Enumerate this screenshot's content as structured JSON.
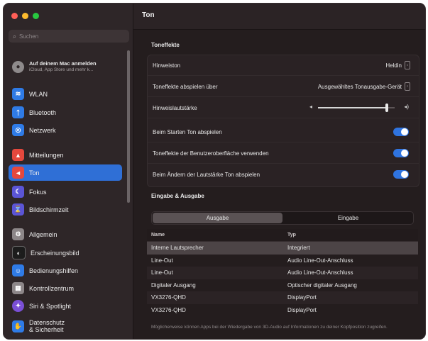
{
  "sidebar": {
    "search_placeholder": "Suchen",
    "account": {
      "line1": "Auf deinem Mac anmelden",
      "line2": "iCloud, App Store und mehr k..."
    },
    "items": [
      {
        "label": "WLAN",
        "icon": "wifi-icon",
        "color": "#2f7be6"
      },
      {
        "label": "Bluetooth",
        "icon": "bluetooth-icon",
        "color": "#2f7be6"
      },
      {
        "label": "Netzwerk",
        "icon": "globe-icon",
        "color": "#2f7be6"
      },
      {
        "label": "Mitteilungen",
        "icon": "bell-icon",
        "color": "#e5483d"
      },
      {
        "label": "Ton",
        "icon": "speaker-icon",
        "color": "#e5483d"
      },
      {
        "label": "Fokus",
        "icon": "moon-icon",
        "color": "#5b55d6"
      },
      {
        "label": "Bildschirmzeit",
        "icon": "hourglass-icon",
        "color": "#5b55d6"
      },
      {
        "label": "Allgemein",
        "icon": "gear-icon",
        "color": "#8c8688"
      },
      {
        "label": "Erscheinungsbild",
        "icon": "appearance-icon",
        "color": "#1c1c1c"
      },
      {
        "label": "Bedienungshilfen",
        "icon": "accessibility-icon",
        "color": "#2f7be6"
      },
      {
        "label": "Kontrollzentrum",
        "icon": "control-center-icon",
        "color": "#8c8688"
      },
      {
        "label": "Siri & Spotlight",
        "icon": "siri-icon",
        "color": "#7a4fd6"
      },
      {
        "label": "Datenschutz\n& Sicherheit",
        "icon": "hand-icon",
        "color": "#2f7be6"
      }
    ],
    "selected": "Ton"
  },
  "header": {
    "title": "Ton"
  },
  "toneffekte": {
    "heading": "Toneffekte",
    "hinweiston_label": "Hinweiston",
    "hinweiston_value": "Heldin",
    "abspielen_label": "Toneffekte abspielen über",
    "abspielen_value": "Ausgewähltes Tonausgabe-Gerät",
    "lautstaerke_label": "Hinweislautstärke",
    "lautstaerke_level": 0.9,
    "start_label": "Beim Starten Ton abspielen",
    "start_on": true,
    "ui_label": "Toneffekte der Benutzeroberfläche verwenden",
    "ui_on": true,
    "aendern_label": "Beim Ändern der Lautstärke Ton abspielen",
    "aendern_on": true
  },
  "io": {
    "heading": "Eingabe & Ausgabe",
    "tabs": [
      "Ausgabe",
      "Eingabe"
    ],
    "active_tab": "Ausgabe",
    "columns": [
      "Name",
      "Typ"
    ],
    "rows": [
      {
        "name": "Interne Lautsprecher",
        "type": "Integriert"
      },
      {
        "name": "Line-Out",
        "type": "Audio Line-Out-Anschluss"
      },
      {
        "name": "Line-Out",
        "type": "Audio Line-Out-Anschluss"
      },
      {
        "name": "Digitaler Ausgang",
        "type": "Optischer digitaler Ausgang"
      },
      {
        "name": "VX3276-QHD",
        "type": "DisplayPort"
      },
      {
        "name": "VX3276-QHD",
        "type": "DisplayPort"
      }
    ],
    "footnote": "Möglicherweise können Apps bei der Wiedergabe von 3D-Audio auf Informationen zu deiner Kopfposition zugreifen."
  }
}
